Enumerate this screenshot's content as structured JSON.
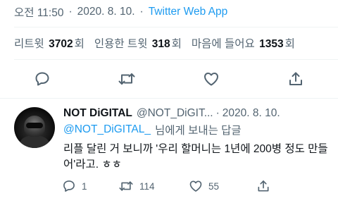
{
  "tweet_meta": {
    "time": "오전 11:50",
    "date": "2020. 8. 10.",
    "separator": "·",
    "app": "Twitter Web App"
  },
  "stats": {
    "retweets": {
      "label_pre": "리트윗",
      "value": "3702",
      "label_post": "회"
    },
    "quotes": {
      "label_pre": "인용한 트윗",
      "value": "318",
      "label_post": "회"
    },
    "likes": {
      "label_pre": "마음에 들어요",
      "value": "1353",
      "label_post": "회"
    }
  },
  "actions": {
    "icons": [
      "comment-icon",
      "retweet-icon",
      "heart-icon",
      "share-icon"
    ],
    "color": "#536471"
  },
  "reply": {
    "display_name": "NOT DiGITAL",
    "handle": "@NOT_DiGIT...",
    "separator": "·",
    "date": "2020. 8. 10.",
    "reply_to_handle": "@NOT_DiGITAL_",
    "reply_to_suffix": "님에게 보내는 답글",
    "text": "리플 달린 거 보니까 '우리 할머니는 1년에 200병 정도 만들어'라고. ㅎㅎ",
    "counts": {
      "replies": "1",
      "retweets": "114",
      "likes": "55"
    }
  },
  "colors": {
    "accent": "#1d9bf0",
    "secondary_text": "#536471",
    "primary_text": "#0f1419",
    "divider": "#eff3f4"
  }
}
